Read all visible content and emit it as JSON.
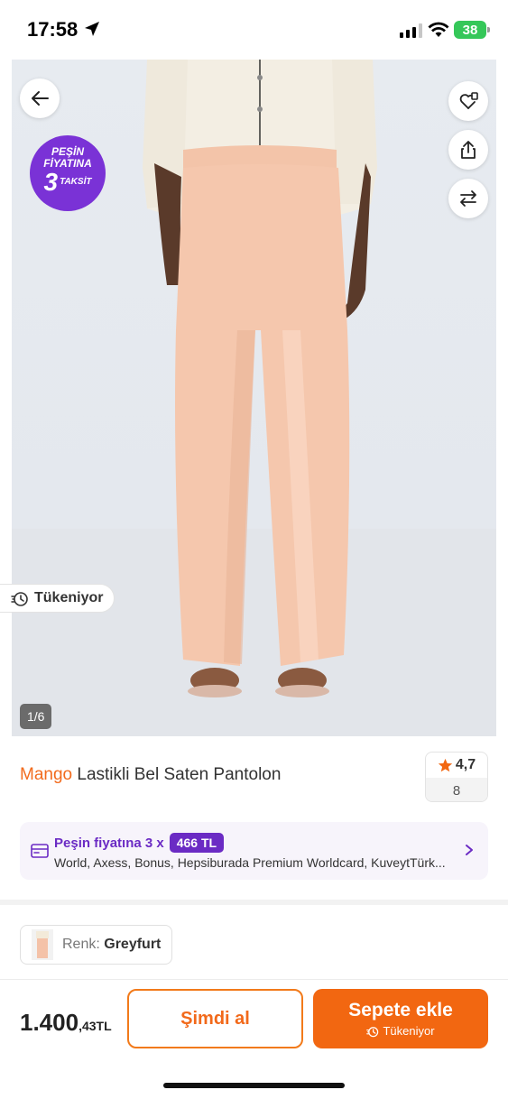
{
  "status_bar": {
    "time": "17:58",
    "battery": "38"
  },
  "hero": {
    "promo": {
      "line1": "PEŞİN",
      "line2": "FİYATINA",
      "number": "3",
      "word": "TAKSİT"
    },
    "stock_chip": "Tükeniyor",
    "page_indicator": "1/6"
  },
  "product": {
    "brand": "Mango",
    "name": "Lastikli Bel Saten Pantolon",
    "rating": "4,7",
    "review_count": "8"
  },
  "installment": {
    "label": "Peşin fiyatına 3 x",
    "amount": "466 TL",
    "banks": "World, Axess, Bonus, Hepsiburada Premium Worldcard, KuveytTürk..."
  },
  "color": {
    "label": "Renk:",
    "value": "Greyfurt"
  },
  "bottom": {
    "price_main": "1.400",
    "price_sub": ",43TL",
    "buy_now": "Şimdi al",
    "add_to_cart": "Sepete ekle",
    "add_to_cart_sub": "Tükeniyor"
  },
  "colors": {
    "brand_orange": "#f26711",
    "promo_purple": "#7a32d6",
    "installment_purple": "#6b2bc4"
  },
  "icons": [
    "location-arrow-icon",
    "signal-icon",
    "wifi-icon",
    "back-arrow-icon",
    "heart-plus-icon",
    "share-icon",
    "compare-icon",
    "stopwatch-icon",
    "star-icon",
    "card-icon",
    "chevron-right-icon"
  ]
}
